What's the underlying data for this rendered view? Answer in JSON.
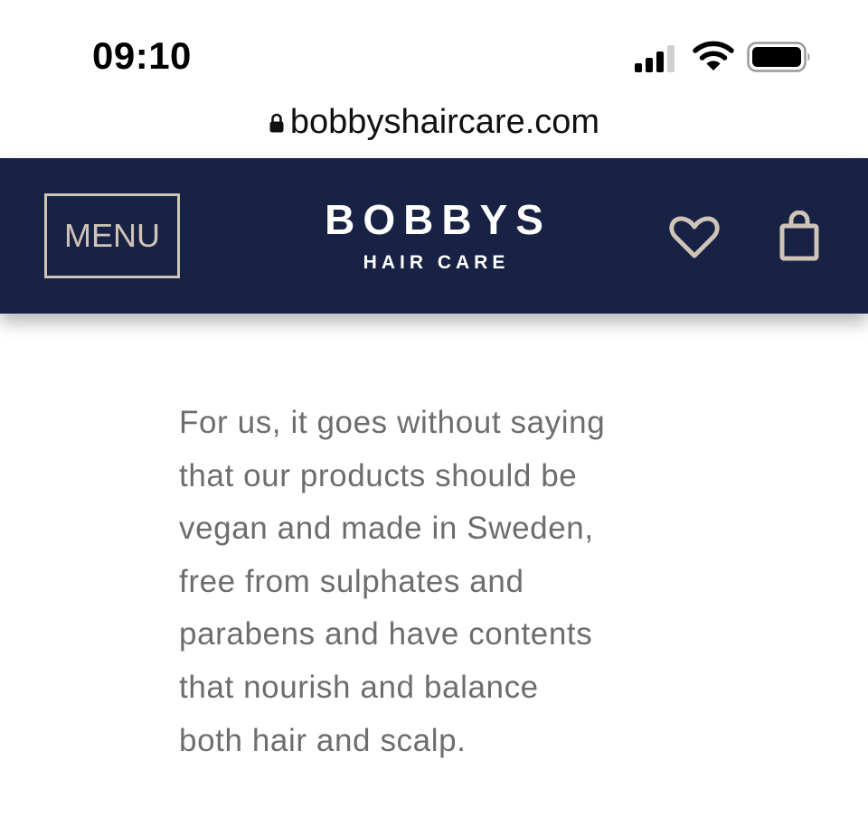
{
  "status_bar": {
    "time": "09:10",
    "icons": [
      "signal-icon",
      "wifi-icon",
      "battery-icon"
    ]
  },
  "browser": {
    "url": "bobbyshaircare.com",
    "lock_icon": "lock-icon"
  },
  "header": {
    "menu_label": "MENU",
    "logo_title": "BOBBYS",
    "logo_subtitle": "HAIR CARE",
    "icons": [
      "heart-icon",
      "bag-icon"
    ],
    "colors": {
      "background": "#182245",
      "accent": "#cfc4b6",
      "logo": "#ffffff"
    }
  },
  "content": {
    "paragraph": "For us, it goes without saying\nthat our products should be\nvegan and made in Sweden,\nfree from sulphates and\nparabens   and have contents\nthat nourish and balance\nboth hair and scalp.",
    "text_color": "#6d6d6d"
  }
}
